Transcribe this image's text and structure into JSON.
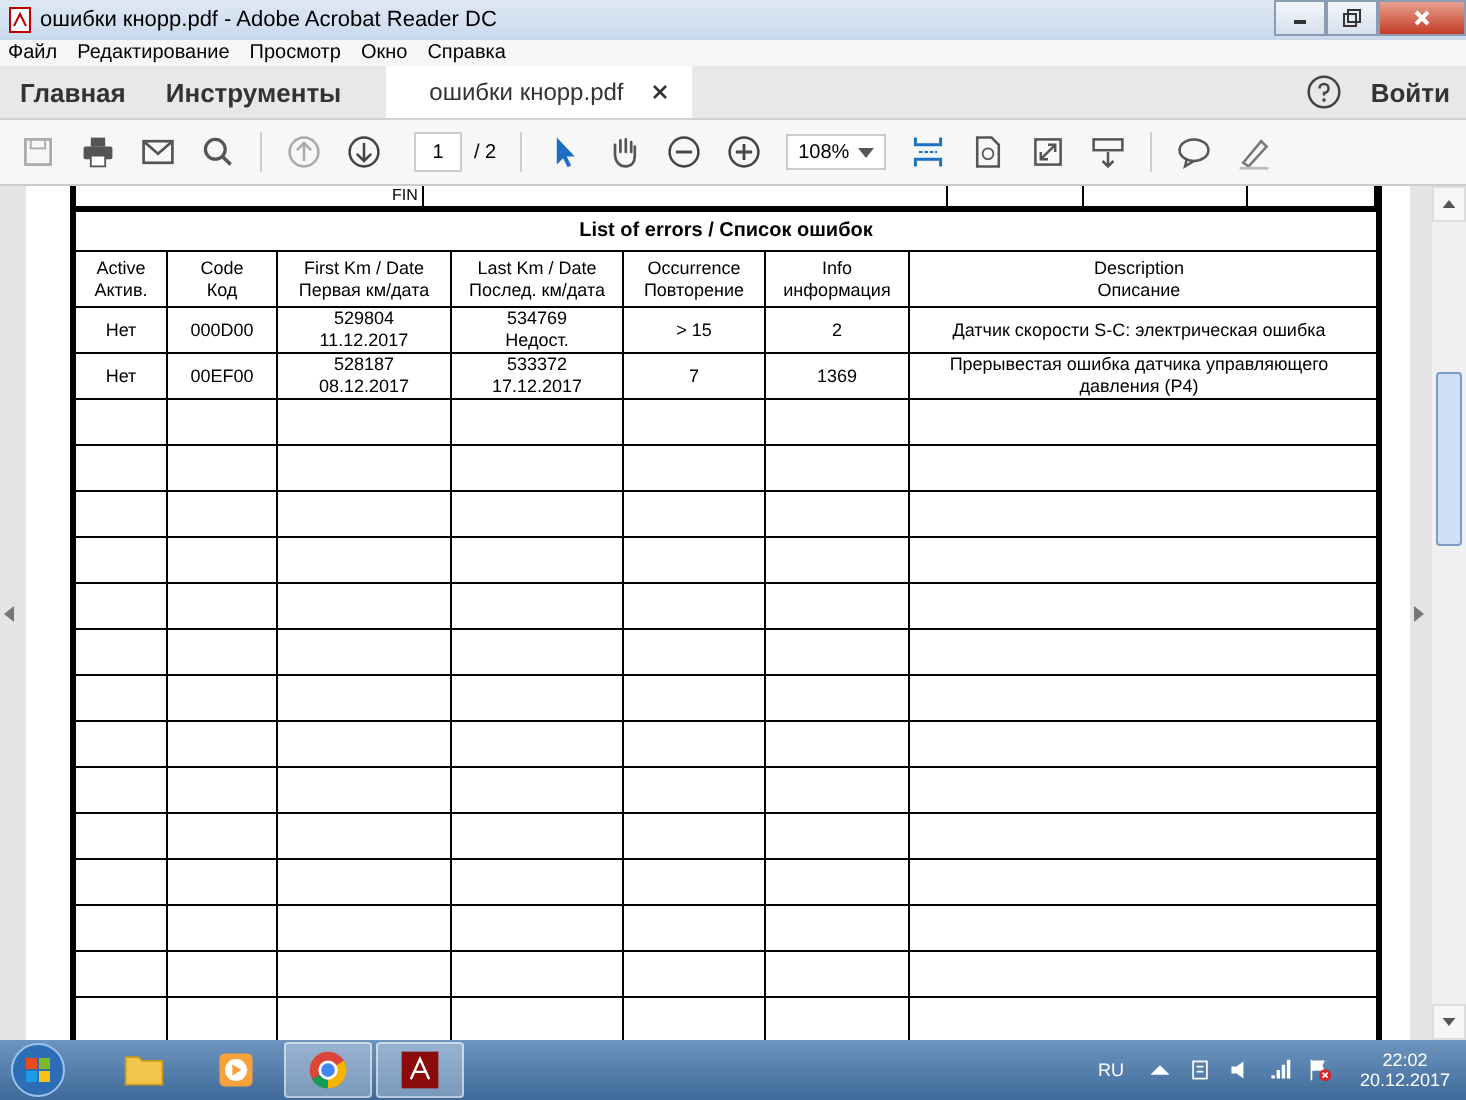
{
  "window": {
    "title": "ошибки кнорр.pdf - Adobe Acrobat Reader DC"
  },
  "menu": [
    "Файл",
    "Редактирование",
    "Просмотр",
    "Окно",
    "Справка"
  ],
  "tabs": [
    {
      "label": "Главная",
      "selected": false,
      "closable": false
    },
    {
      "label": "Инструменты",
      "selected": false,
      "closable": false
    },
    {
      "label": "ошибки кнорр.pdf",
      "selected": true,
      "closable": true
    }
  ],
  "signin": "Войти",
  "toolbar": {
    "page": "1",
    "page_total": "/ 2",
    "zoom": "108%"
  },
  "document": {
    "cut_row_label": "FIN",
    "table_title": "List of errors / Список ошибок",
    "columns": [
      "Active\nАктив.",
      "Code\nКод",
      "First Km / Date\nПервая км/дата",
      "Last Km / Date\nПослед. км/дата",
      "Occurrence\nПовторение",
      "Info\nинформация",
      "Description\nОписание"
    ],
    "rows": [
      [
        "Нет",
        "000D00",
        "529804\n11.12.2017",
        "534769\nНедост.",
        "> 15",
        "2",
        "Датчик скорости S-C: электрическая ошибка"
      ],
      [
        "Нет",
        "00EF00",
        "528187\n08.12.2017",
        "533372\n17.12.2017",
        "7",
        "1369",
        "Прерывестая ошибка датчика управляющего давления (P4)"
      ]
    ]
  },
  "taskbar": {
    "apps": [
      {
        "kind": "folder",
        "selected": false
      },
      {
        "kind": "media",
        "selected": false
      },
      {
        "kind": "browser",
        "selected": true
      },
      {
        "kind": "pdf",
        "selected": true
      }
    ],
    "language": "RU",
    "time": "22:02",
    "date": "20.12.2017"
  }
}
